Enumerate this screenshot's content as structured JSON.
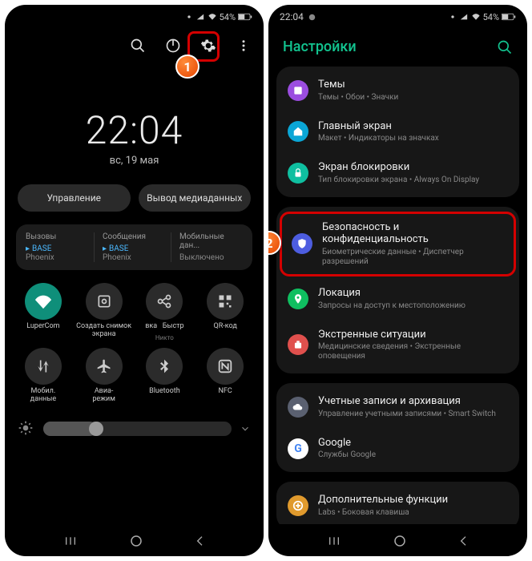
{
  "left": {
    "status": {
      "battery": "54%",
      "signal": "📶",
      "wifi": "📡"
    },
    "clock": {
      "time": "22:04",
      "date": "вс, 19 мая"
    },
    "pills": {
      "control": "Управление",
      "media": "Вывод медиаданных"
    },
    "sim": {
      "calls": {
        "label": "Вызовы",
        "op": "BASE",
        "name": "Phoenix"
      },
      "sms": {
        "label": "Сообщения",
        "op": "BASE",
        "name": "Phoenix"
      },
      "data": {
        "label": "Мобильные дан...",
        "op": "",
        "name": "Выключено"
      }
    },
    "qs": [
      {
        "label": "LuperCom",
        "sub": "",
        "on": true,
        "icon": "wifi"
      },
      {
        "label": "Создать снимок",
        "sub": "экрана",
        "on": false,
        "icon": "capture"
      },
      {
        "label1": "вка",
        "label2": "Быстр",
        "sub": "Никто",
        "on": false,
        "icon": "share"
      },
      {
        "label": "QR-код",
        "sub": "",
        "on": false,
        "icon": "qr"
      },
      {
        "label": "Мобил.",
        "sub": "данные",
        "on": false,
        "icon": "updown"
      },
      {
        "label": "Авиа-",
        "sub": "режим",
        "on": false,
        "icon": "plane"
      },
      {
        "label": "Bluetooth",
        "sub": "",
        "on": false,
        "icon": "bt"
      },
      {
        "label": "NFC",
        "sub": "",
        "on": false,
        "icon": "nfc"
      }
    ],
    "brightness_pct": 28
  },
  "right": {
    "status": {
      "time": "22:04",
      "battery": "54%"
    },
    "title": "Настройки",
    "items": [
      {
        "icon": "#9b4de0",
        "glyph": "themes",
        "title": "Темы",
        "sub": "Темы • Обои • Значки"
      },
      {
        "icon": "#0aa6d6",
        "glyph": "home",
        "title": "Главный экран",
        "sub": "Макет • Индикаторы на значках"
      },
      {
        "icon": "#0fbfa0",
        "glyph": "lock",
        "title": "Экран блокировки",
        "sub": "Тип блокировки экрана • Always On Display"
      },
      {
        "icon": "#4d5de0",
        "glyph": "shield",
        "title": "Безопасность и конфиденциальность",
        "sub": "Биометрические данные • Диспетчер разрешений",
        "highlight": true
      },
      {
        "icon": "#0fbf60",
        "glyph": "pin",
        "title": "Локация",
        "sub": "Запросы на доступ к местоположению"
      },
      {
        "icon": "#e0504d",
        "glyph": "sos",
        "title": "Экстренные ситуации",
        "sub": "Медицинские сведения • Экстренные оповещения"
      },
      {
        "icon": "#5a6070",
        "glyph": "cloud",
        "title": "Учетные записи и архивация",
        "sub": "Управление учетными записями • Smart Switch"
      },
      {
        "icon": "#fff",
        "glyph": "google",
        "title": "Google",
        "sub": "Службы Google"
      },
      {
        "icon": "#e09a2d",
        "glyph": "plus",
        "title": "Дополнительные функции",
        "sub": "Labs • Боковая клавиша"
      }
    ]
  },
  "badges": {
    "one": "1",
    "two": "2"
  }
}
